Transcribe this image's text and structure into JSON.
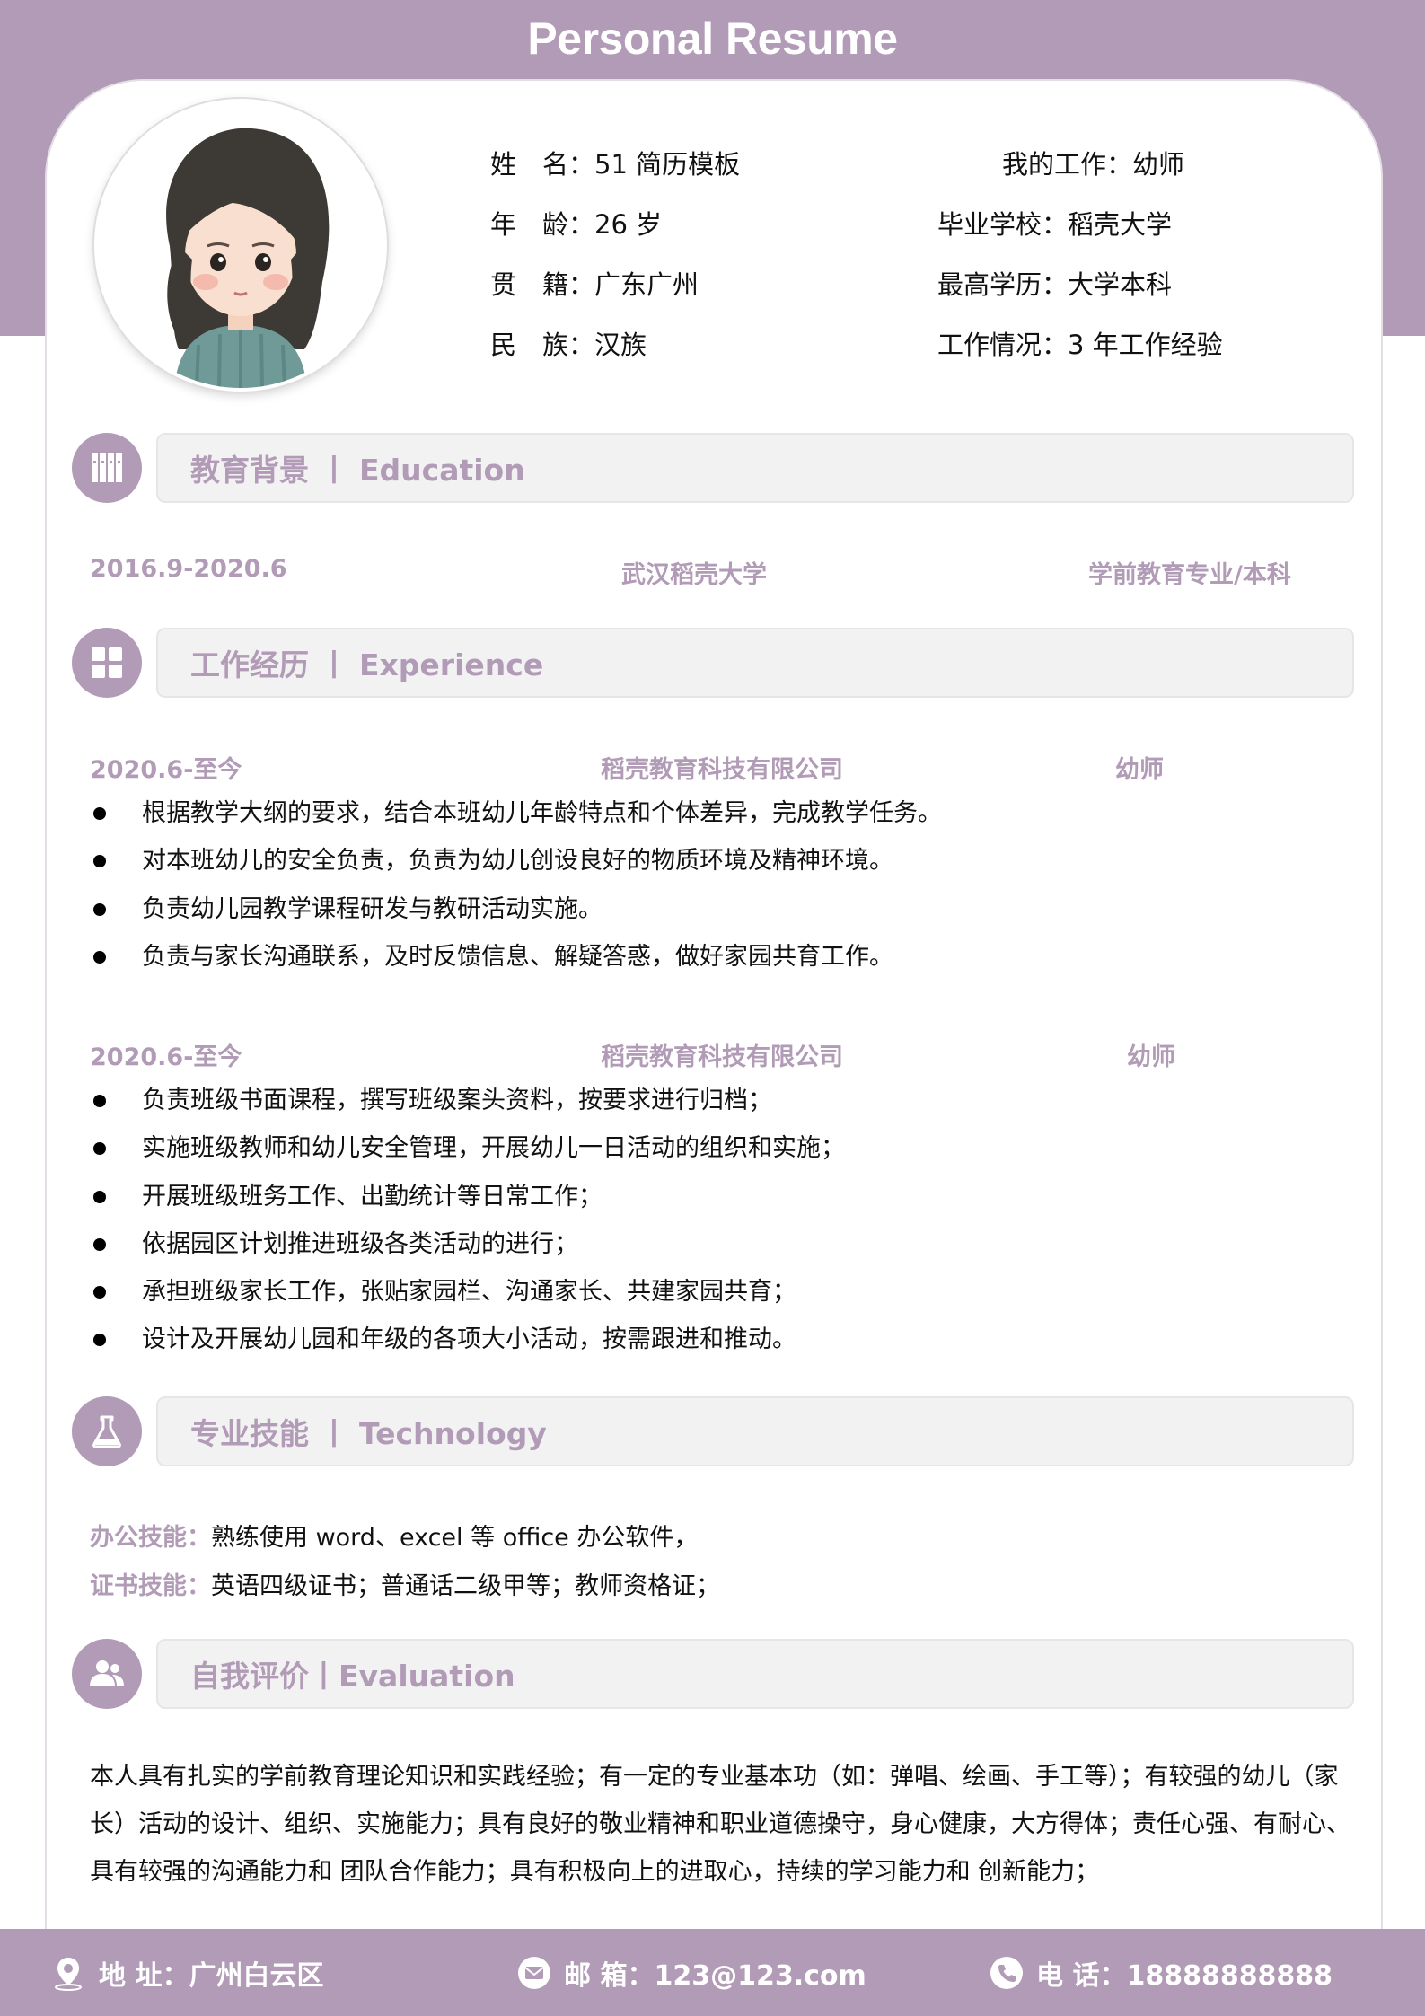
{
  "title": "Personal Resume",
  "profile": {
    "fields": [
      {
        "label": "姓　名：",
        "value": "51 简历模板"
      },
      {
        "label": "年　龄：",
        "value": "26 岁"
      },
      {
        "label": "贯　籍：",
        "value": "广东广州"
      },
      {
        "label": "民　族：",
        "value": "汉族"
      },
      {
        "label": "我的工作：",
        "value": "幼师"
      },
      {
        "label": "毕业学校：",
        "value": "稻壳大学"
      },
      {
        "label": "最高学历：",
        "value": "大学本科"
      },
      {
        "label": "工作情况：",
        "value": "3 年工作经验"
      }
    ]
  },
  "sections": {
    "education": "教育背景 丨 Education",
    "experience": "工作经历 丨 Experience",
    "technology": "专业技能 丨 Technology",
    "evaluation": "自我评价丨Evaluation"
  },
  "education": {
    "period": "2016.9-2020.6",
    "school": "武汉稻壳大学",
    "major": "学前教育专业/本科"
  },
  "experience": [
    {
      "period": "2020.6-至今",
      "company": "稻壳教育科技有限公司",
      "role": "幼师",
      "duties": [
        "根据教学大纲的要求，结合本班幼儿年龄特点和个体差异，完成教学任务。",
        "对本班幼儿的安全负责，负责为幼儿创设良好的物质环境及精神环境。",
        "负责幼儿园教学课程研发与教研活动实施。",
        "负责与家长沟通联系，及时反馈信息、解疑答惑，做好家园共育工作。"
      ]
    },
    {
      "period": "2020.6-至今",
      "company": "稻壳教育科技有限公司",
      "role": "幼师",
      "duties": [
        "负责班级书面课程，撰写班级案头资料，按要求进行归档；",
        "实施班级教师和幼儿安全管理，开展幼儿一日活动的组织和实施；",
        "开展班级班务工作、出勤统计等日常工作；",
        "依据园区计划推进班级各类活动的进行；",
        "承担班级家长工作，张贴家园栏、沟通家长、共建家园共育；",
        "设计及开展幼儿园和年级的各项大小活动，按需跟进和推动。"
      ]
    }
  ],
  "skills": [
    {
      "label": "办公技能：",
      "value": "熟练使用 word、excel 等 office 办公软件，"
    },
    {
      "label": "证书技能：",
      "value": "英语四级证书；普通话二级甲等；教师资格证；"
    }
  ],
  "evaluation": {
    "lines": [
      "本人具有扎实的学前教育理论知识和实践经验；有一定的专业基本功（如：弹唱、绘画、手工等）；有较强的幼儿（家",
      "长）活动的设计、组织、实施能力；具有良好的敬业精神和职业道德操守，身心健康，大方得体；责任心强、有耐心、",
      "具有较强的沟通能力和 团队合作能力；具有积极向上的进取心，持续的学习能力和 创新能力；"
    ]
  },
  "footer": {
    "address": "地  址：广州白云区",
    "email": "邮  箱：123@123.com",
    "phone": "电  话：18888888888"
  },
  "colors": {
    "accent": "#b19bb6",
    "bar": "#f2f2f2"
  },
  "icons": [
    "books-icon",
    "grid-icon",
    "flask-icon",
    "people-icon",
    "location-icon",
    "mail-icon",
    "phone-icon"
  ]
}
